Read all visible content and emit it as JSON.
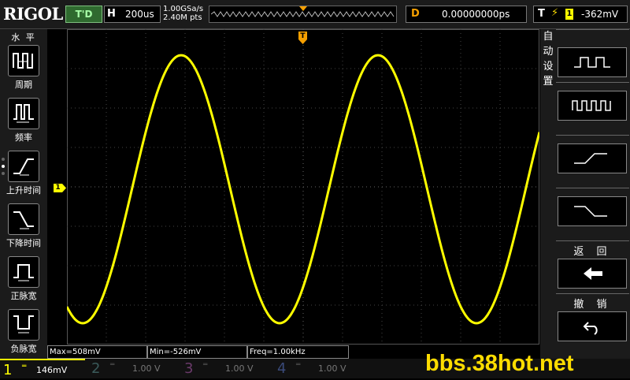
{
  "header": {
    "logo": "RIGOL",
    "run_state": "T'D",
    "timebase_key": "H",
    "timebase_value": "200us",
    "sample_rate": "1.00GSa/s",
    "memory_depth": "2.40M pts",
    "delay_key": "D",
    "delay_value": "0.00000000ps",
    "trigger_key": "T",
    "trigger_channel": "1",
    "trigger_level": "-362mV"
  },
  "left_menu": {
    "title": "水 平",
    "items": [
      {
        "label": "周期",
        "icon": "period-icon"
      },
      {
        "label": "频率",
        "icon": "frequency-icon"
      },
      {
        "label": "上升时间",
        "icon": "rise-time-icon"
      },
      {
        "label": "下降时间",
        "icon": "fall-time-icon"
      },
      {
        "label": "正脉宽",
        "icon": "positive-width-icon"
      },
      {
        "label": "负脉宽",
        "icon": "negative-width-icon"
      }
    ]
  },
  "right_menu": {
    "title_chars": [
      "自",
      "动",
      "设",
      "置"
    ],
    "back_label": "返 回",
    "undo_label": "撤 销"
  },
  "markers": {
    "trigger_top": "T",
    "channel_left": "1"
  },
  "measurements": {
    "max": "Max=508mV",
    "min": "Min=-526mV",
    "freq": "Freq=1.00kHz"
  },
  "channels": [
    {
      "num": "1",
      "coupling": "═",
      "scale": "146mV",
      "color": "#ffff00"
    },
    {
      "num": "2",
      "coupling": "═",
      "scale": "1.00 V",
      "color": "#00c0c0"
    },
    {
      "num": "3",
      "coupling": "═",
      "scale": "1.00 V",
      "color": "#ff00ff"
    },
    {
      "num": "4",
      "coupling": "═",
      "scale": "1.00 V",
      "color": "#3080ff"
    }
  ],
  "watermark": "bbs.38hot.net",
  "colors": {
    "ch1": "#ffff00",
    "accent": "#f6a000",
    "grid": "#555555"
  }
}
